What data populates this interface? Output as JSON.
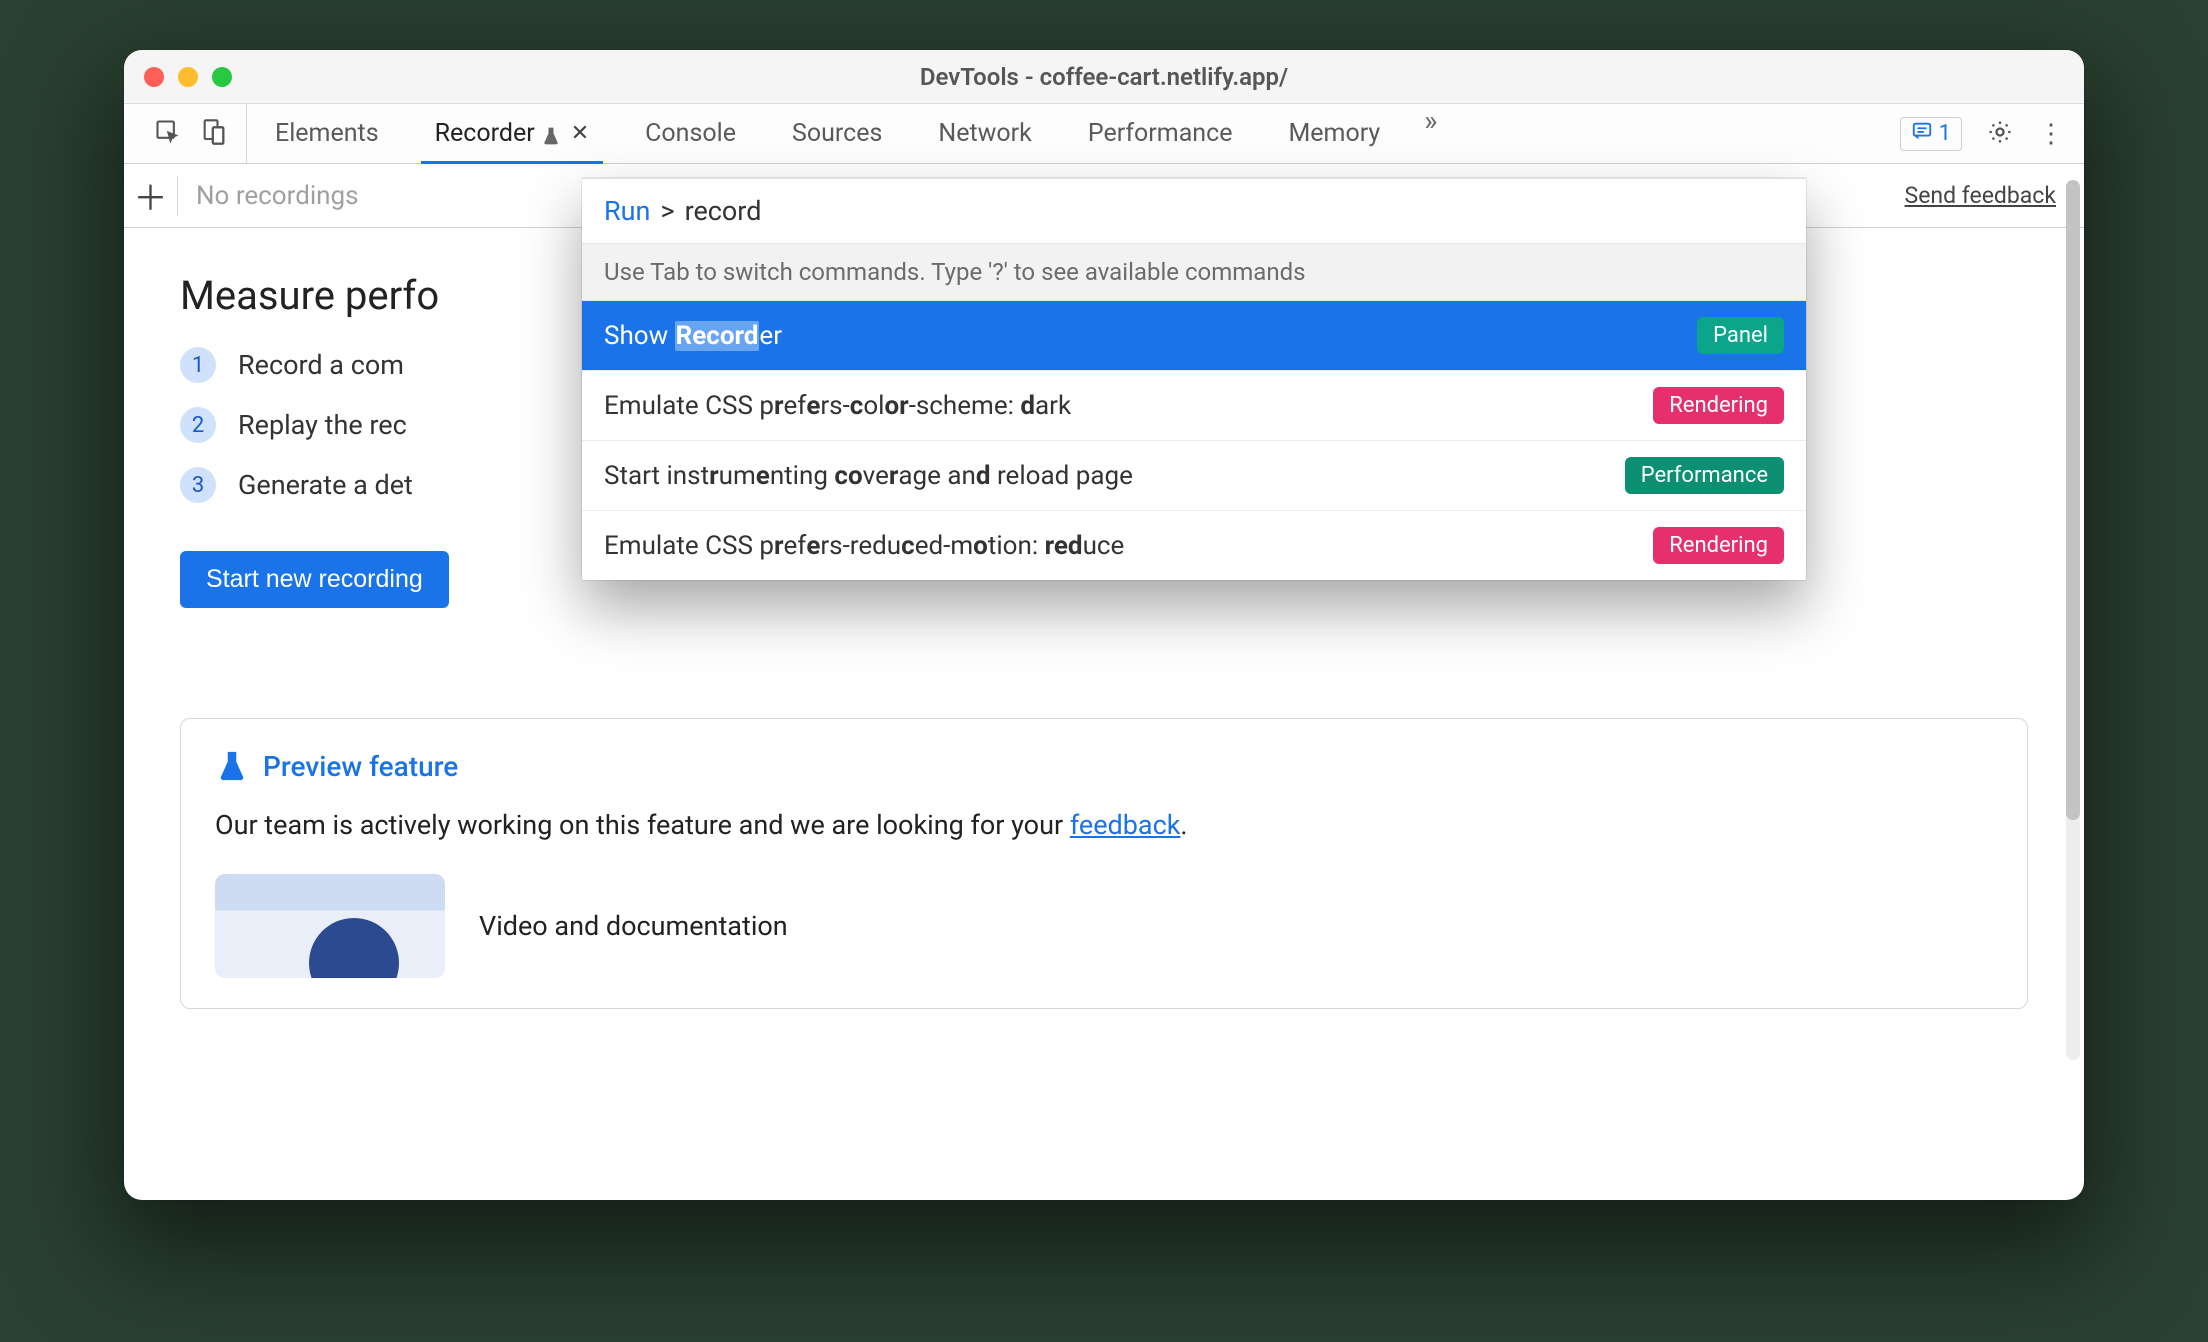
{
  "window": {
    "title": "DevTools - coffee-cart.netlify.app/"
  },
  "tabs": {
    "items": [
      {
        "label": "Elements"
      },
      {
        "label": "Recorder"
      },
      {
        "label": "Console"
      },
      {
        "label": "Sources"
      },
      {
        "label": "Network"
      },
      {
        "label": "Performance"
      },
      {
        "label": "Memory"
      }
    ],
    "active_index": 1
  },
  "right": {
    "issues_count": "1"
  },
  "subtoolbar": {
    "no_recordings": "No recordings",
    "send_feedback": "Send feedback"
  },
  "page": {
    "heading": "Measure perfo",
    "steps": [
      "Record a com",
      "Replay the rec",
      "Generate a det"
    ],
    "start_button": "Start new recording",
    "preview_title": "Preview feature",
    "preview_text_pre": "Our team is actively working on this feature and we are looking for your ",
    "preview_link": "feedback",
    "preview_text_post": ".",
    "doc_title": "Video and documentation"
  },
  "palette": {
    "run_label": "Run",
    "query": "record",
    "hint": "Use Tab to switch commands. Type '?' to see available commands",
    "items": [
      {
        "text": "Show Recorder",
        "badge": "Panel",
        "badge_kind": "teal",
        "selected": true
      },
      {
        "text": "Emulate CSS prefers-color-scheme: dark",
        "badge": "Rendering",
        "badge_kind": "magenta"
      },
      {
        "text": "Start instrumenting coverage and reload page",
        "badge": "Performance",
        "badge_kind": "green"
      },
      {
        "text": "Emulate CSS prefers-reduced-motion: reduce",
        "badge": "Rendering",
        "badge_kind": "magenta"
      }
    ]
  }
}
